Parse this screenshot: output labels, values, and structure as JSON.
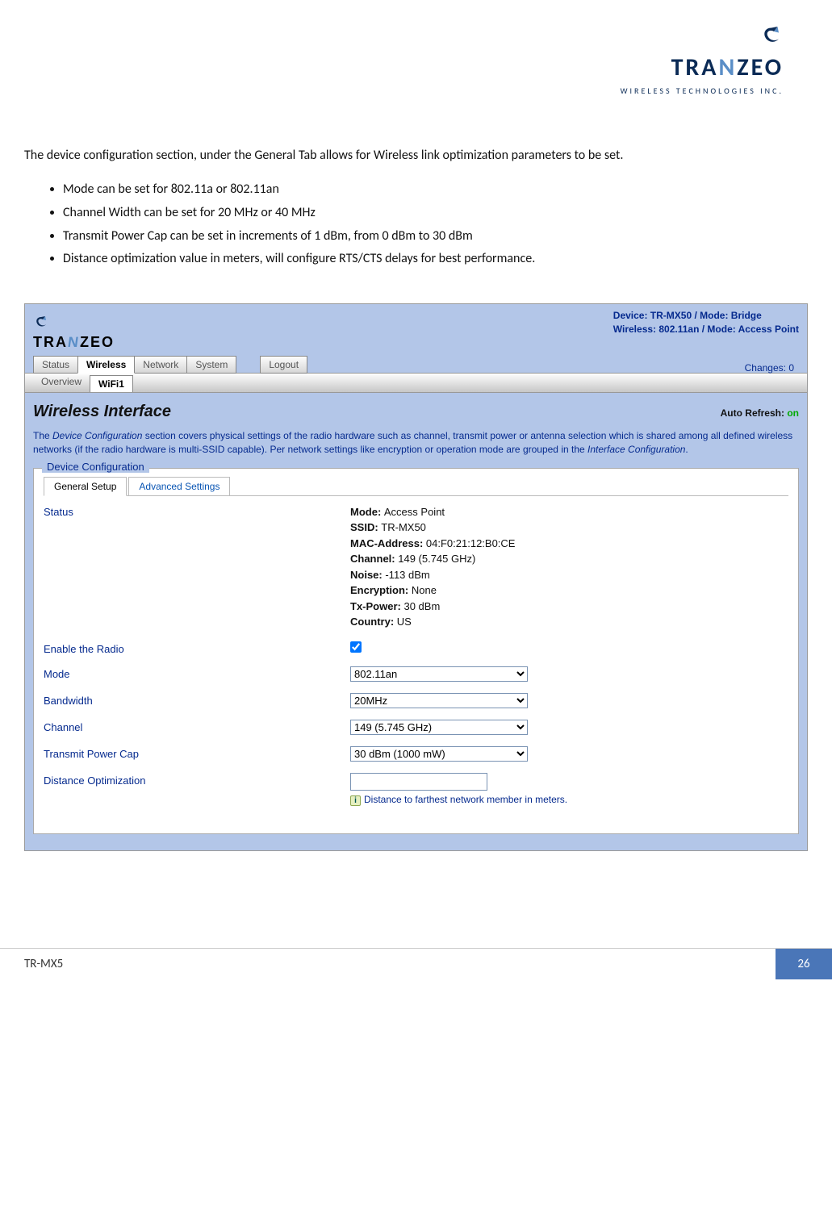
{
  "header_logo": {
    "brand_pre": "TRA",
    "brand_mid": "N",
    "brand_post": "ZEO",
    "sub": "WIRELESS TECHNOLOGIES INC."
  },
  "intro": "The device configuration section, under the General Tab allows for Wireless link optimization parameters to be set.",
  "features": [
    "Mode can be set for 802.11a or 802.11an",
    "Channel Width can be set for 20 MHz or 40 MHz",
    "Transmit Power Cap can be set in increments of 1 dBm, from 0 dBm to 30 dBm",
    "Distance optimization value in meters, will configure RTS/CTS delays for best performance."
  ],
  "screenshot": {
    "brand": {
      "pre": "TRA",
      "mid": "N",
      "post": "ZEO"
    },
    "device_line1": "Device: TR-MX50 / Mode: Bridge",
    "device_line2": "Wireless: 802.11an / Mode: Access Point",
    "tabs_main": {
      "status": "Status",
      "wireless": "Wireless",
      "network": "Network",
      "system": "System",
      "logout": "Logout"
    },
    "changes": "Changes: 0",
    "tabs_sub": {
      "overview": "Overview",
      "wifi1": "WiFi1"
    },
    "section_title": "Wireless Interface",
    "auto_refresh_label": "Auto Refresh:",
    "auto_refresh_state": "on",
    "description_1": "The ",
    "description_i1": "Device Configuration",
    "description_2": " section covers physical settings of the radio hardware such as channel, transmit power or antenna selection which is shared among all defined wireless networks (if the radio hardware is multi-SSID capable). Per network settings like encryption or operation mode are grouped in the ",
    "description_i2": "Interface Configuration",
    "description_3": ".",
    "fieldset_legend": "Device Configuration",
    "inner_tabs": {
      "general": "General Setup",
      "advanced": "Advanced Settings"
    },
    "labels": {
      "status": "Status",
      "enable": "Enable the Radio",
      "mode": "Mode",
      "bandwidth": "Bandwidth",
      "channel": "Channel",
      "txpower": "Transmit Power Cap",
      "distance": "Distance Optimization"
    },
    "status_vals": {
      "mode_l": "Mode: ",
      "mode_v": "Access Point",
      "ssid_l": "SSID: ",
      "ssid_v": "TR-MX50",
      "mac_l": "MAC-Address: ",
      "mac_v": "04:F0:21:12:B0:CE",
      "chan_l": "Channel: ",
      "chan_v": "149 (5.745 GHz)",
      "noise_l": "Noise: ",
      "noise_v": "-113 dBm",
      "enc_l": "Encryption: ",
      "enc_v": "None",
      "txp_l": "Tx-Power: ",
      "txp_v": "30 dBm",
      "ctry_l": "Country: ",
      "ctry_v": "US"
    },
    "selects": {
      "mode": "802.11an",
      "bandwidth": "20MHz",
      "channel": "149 (5.745 GHz)",
      "txpower": "30 dBm (1000 mW)"
    },
    "distance_hint": "Distance to farthest network member in meters."
  },
  "footer": {
    "left": "TR-MX5",
    "right": "26"
  }
}
